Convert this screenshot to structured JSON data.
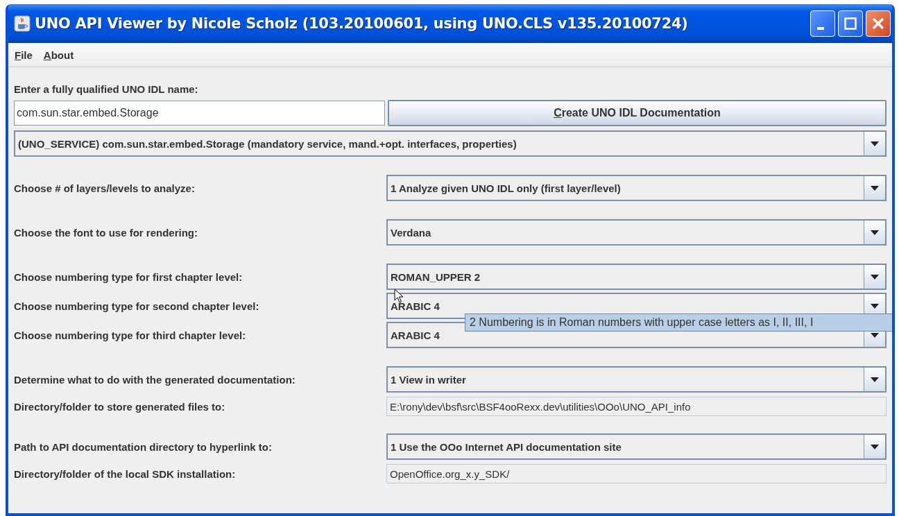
{
  "window": {
    "title": "UNO API Viewer by Nicole Scholz (103.20100601, using UNO.CLS v135.20100724)"
  },
  "menu": [
    {
      "label": "File"
    },
    {
      "label": "About"
    }
  ],
  "name_entry": {
    "label": "Enter a fully qualified UNO IDL name:",
    "value": "com.sun.star.embed.Storage",
    "button": "Create UNO IDL Documentation",
    "service": "(UNO_SERVICE)   com.sun.star.embed.Storage (mandatory service, mand.+opt. interfaces, properties)"
  },
  "sections": [
    [
      {
        "kind": "combo",
        "label": "Choose # of layers/levels to analyze:",
        "value": "1 Analyze given UNO IDL only (first layer/level)"
      }
    ],
    [
      {
        "kind": "combo",
        "label": "Choose the font to use for rendering:",
        "value": "Verdana"
      }
    ],
    [
      {
        "kind": "combo",
        "label": "Choose numbering type for first chapter level:",
        "value": "ROMAN_UPPER 2"
      },
      {
        "kind": "combo",
        "label": "Choose numbering type for second chapter level:",
        "value": "ARABIC 4"
      },
      {
        "kind": "combo",
        "label": "Choose numbering type for third chapter level:",
        "value": "ARABIC 4"
      }
    ],
    [
      {
        "kind": "combo",
        "label": "Determine what to do with the generated documentation:",
        "value": "1 View in writer"
      },
      {
        "kind": "path",
        "label": "Directory/folder to store generated files to:",
        "value": "E:\\rony\\dev\\bsf\\src\\BSF4ooRexx.dev\\utilities\\OOo\\UNO_API_info"
      }
    ],
    [
      {
        "kind": "combo",
        "label": "Path to API documentation directory to hyperlink to:",
        "value": "1 Use the OOo Internet API documentation site"
      },
      {
        "kind": "path",
        "label": "Directory/folder of the local SDK installation:",
        "value": "OpenOffice.org_x.y_SDK/"
      }
    ]
  ],
  "tooltip": {
    "text": "2 Numbering is in Roman numbers with upper case letters as I, II, III, I"
  }
}
